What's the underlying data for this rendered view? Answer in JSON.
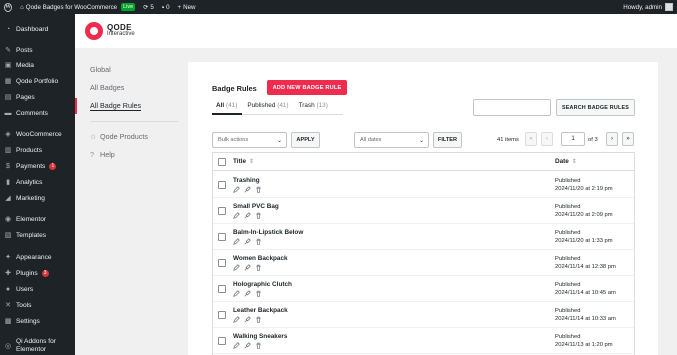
{
  "admin_bar": {
    "site_name": "Qode Badges for WooCommerce",
    "live_label": "Live",
    "updates_count": "5",
    "comments_count": "0",
    "new_label": "New",
    "howdy": "Howdy, admin"
  },
  "sidebar": {
    "items": [
      {
        "label": "Dashboard",
        "icon": "dashboard-icon"
      },
      {
        "label": "Posts",
        "icon": "pin-icon"
      },
      {
        "label": "Media",
        "icon": "media-icon"
      },
      {
        "label": "Qode Portfolio",
        "icon": "portfolio-icon"
      },
      {
        "label": "Pages",
        "icon": "pages-icon"
      },
      {
        "label": "Comments",
        "icon": "comments-icon"
      },
      {
        "label": "WooCommerce",
        "icon": "woocommerce-icon"
      },
      {
        "label": "Products",
        "icon": "products-icon"
      },
      {
        "label": "Payments",
        "icon": "payments-icon",
        "badge": "1"
      },
      {
        "label": "Analytics",
        "icon": "analytics-icon"
      },
      {
        "label": "Marketing",
        "icon": "marketing-icon"
      },
      {
        "label": "Elementor",
        "icon": "elementor-icon"
      },
      {
        "label": "Templates",
        "icon": "templates-icon"
      },
      {
        "label": "Appearance",
        "icon": "appearance-icon"
      },
      {
        "label": "Plugins",
        "icon": "plugins-icon",
        "badge": "3"
      },
      {
        "label": "Users",
        "icon": "users-icon"
      },
      {
        "label": "Tools",
        "icon": "tools-icon"
      },
      {
        "label": "Settings",
        "icon": "settings-icon"
      },
      {
        "label": "Qi Addons for",
        "label2": "Elementor",
        "icon": "qi-addons-icon"
      }
    ]
  },
  "plugin_header": {
    "brand": "QODE",
    "brand_sub": "Interactive"
  },
  "plugin_nav": {
    "items": [
      "Global",
      "All Badges",
      "All Badge Rules"
    ],
    "extra_items": [
      "Qode Products",
      "Help"
    ]
  },
  "main": {
    "title": "Badge Rules",
    "add_button": "ADD NEW BADGE RULE",
    "filters": [
      {
        "label": "All",
        "count": "(41)"
      },
      {
        "label": "Published",
        "count": "(41)"
      },
      {
        "label": "Trash",
        "count": "(13)"
      }
    ],
    "search_placeholder": "",
    "search_button": "SEARCH BADGE RULES",
    "bulk_actions": "Bulk actions",
    "apply": "APPLY",
    "all_dates": "All dates",
    "filter": "FILTER",
    "items_count": "41 items",
    "pagination": {
      "first": "«",
      "prev": "‹",
      "current": "1",
      "of_text": "of 3",
      "next": "›",
      "last": "»"
    },
    "table": {
      "col_title": "Title",
      "col_date": "Date",
      "sort_glyph": "⇕",
      "rows": [
        {
          "title": "Trashing",
          "status": "Published",
          "date": "2024/11/20 at 2:19 pm"
        },
        {
          "title": "Small PVC Bag",
          "status": "Published",
          "date": "2024/11/20 at 2:09 pm"
        },
        {
          "title": "Balm-In-Lipstick Below",
          "status": "Published",
          "date": "2024/11/20 at 1:33 pm"
        },
        {
          "title": "Women Backpack",
          "status": "Published",
          "date": "2024/11/14 at 12:38 pm"
        },
        {
          "title": "Holographic Clutch",
          "status": "Published",
          "date": "2024/11/14 at 10:45 am"
        },
        {
          "title": "Leather Backpack",
          "status": "Published",
          "date": "2024/11/14 at 10:33 am"
        },
        {
          "title": "Walking Sneakers",
          "status": "Published",
          "date": "2024/11/13 at 1:20 pm"
        }
      ]
    }
  },
  "colors": {
    "accent": "#ef2c4d",
    "admin_bg": "#1d2327",
    "live_green": "#00a32a"
  }
}
